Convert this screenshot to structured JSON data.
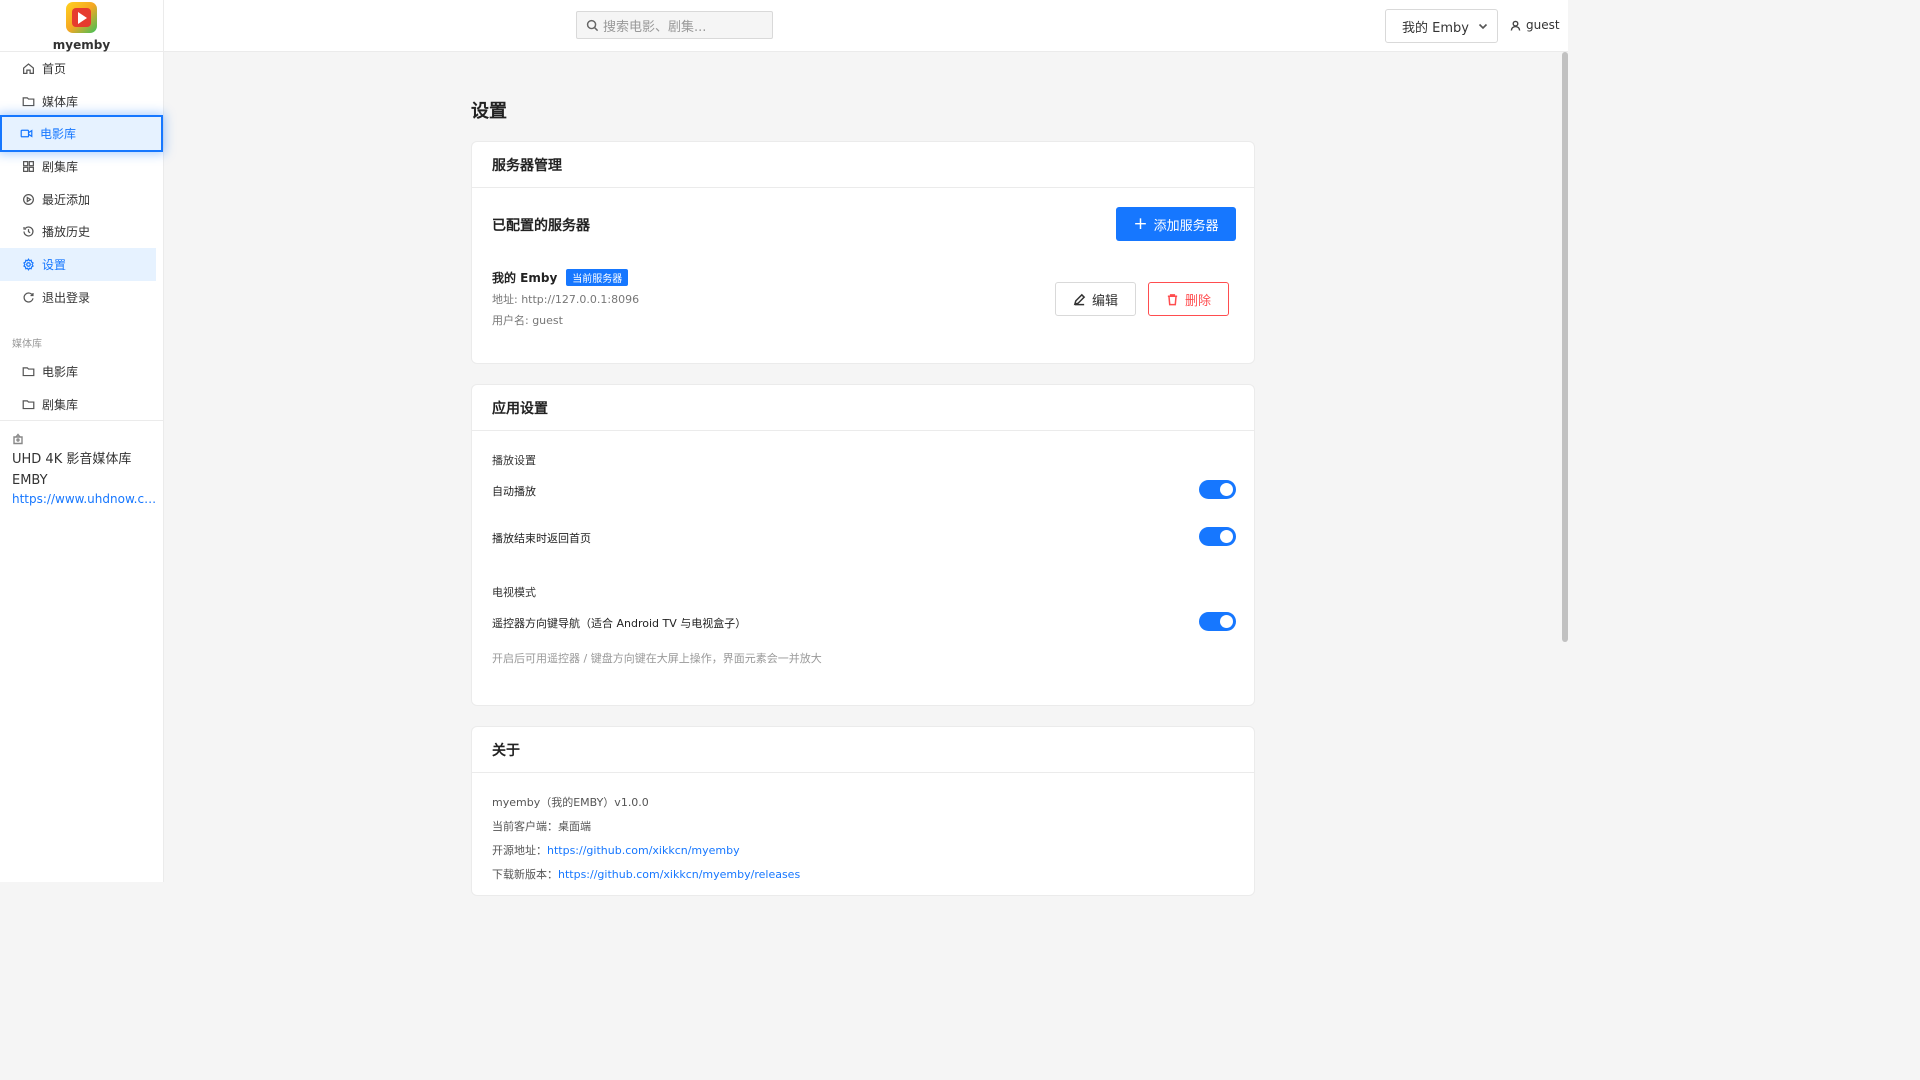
{
  "sidebar": {
    "logo_text": "myemby",
    "items": [
      {
        "label": "首页",
        "icon": "home-icon"
      },
      {
        "label": "媒体库",
        "icon": "folder-icon"
      },
      {
        "label": "电影库",
        "icon": "video-icon"
      },
      {
        "label": "剧集库",
        "icon": "grid-icon"
      },
      {
        "label": "最近添加",
        "icon": "play-circle-icon"
      },
      {
        "label": "播放历史",
        "icon": "history-icon"
      },
      {
        "label": "设置",
        "icon": "gear-icon"
      },
      {
        "label": "退出登录",
        "icon": "logout-icon"
      }
    ],
    "section_label": "媒体库",
    "library_items": [
      {
        "label": "电影库",
        "icon": "folder-icon"
      },
      {
        "label": "剧集库",
        "icon": "folder-icon"
      }
    ],
    "ad": {
      "title": "UHD 4K 影音媒体库 EMBY",
      "link": "https://www.uhdnow.co..."
    }
  },
  "header": {
    "search_placeholder": "搜索电影、剧集...",
    "server_select": "我的 Emby",
    "user": "guest"
  },
  "main": {
    "title": "设置",
    "server_card": {
      "title": "服务器管理",
      "subtitle": "已配置的服务器",
      "add_button": "添加服务器",
      "server": {
        "name": "我的 Emby",
        "badge": "当前服务器",
        "address": "地址: http://127.0.0.1:8096",
        "username": "用户名: guest"
      },
      "edit_button": "编辑",
      "delete_button": "删除"
    },
    "app_card": {
      "title": "应用设置",
      "playback_group": "播放设置",
      "autoplay": {
        "label": "自动播放",
        "enabled": true
      },
      "return_home": {
        "label": "播放结束时返回首页",
        "enabled": true
      },
      "tv_group": "电视模式",
      "remote_nav": {
        "label": "遥控器方向键导航（适合 Android TV 与电视盒子）",
        "enabled": true
      },
      "hint": "开启后可用遥控器 / 键盘方向键在大屏上操作，界面元素会一并放大"
    },
    "about_card": {
      "title": "关于",
      "version": "myemby（我的EMBY）v1.0.0",
      "client": "当前客户端：桌面端",
      "source_label": "开源地址：",
      "source_url": "https://github.com/xikkcn/myemby",
      "download_label": "下载新版本：",
      "download_url": "https://github.com/xikkcn/myemby/releases"
    }
  },
  "colors": {
    "accent": "#1677ff",
    "danger": "#ff4d4f",
    "background": "#f5f5f5"
  }
}
